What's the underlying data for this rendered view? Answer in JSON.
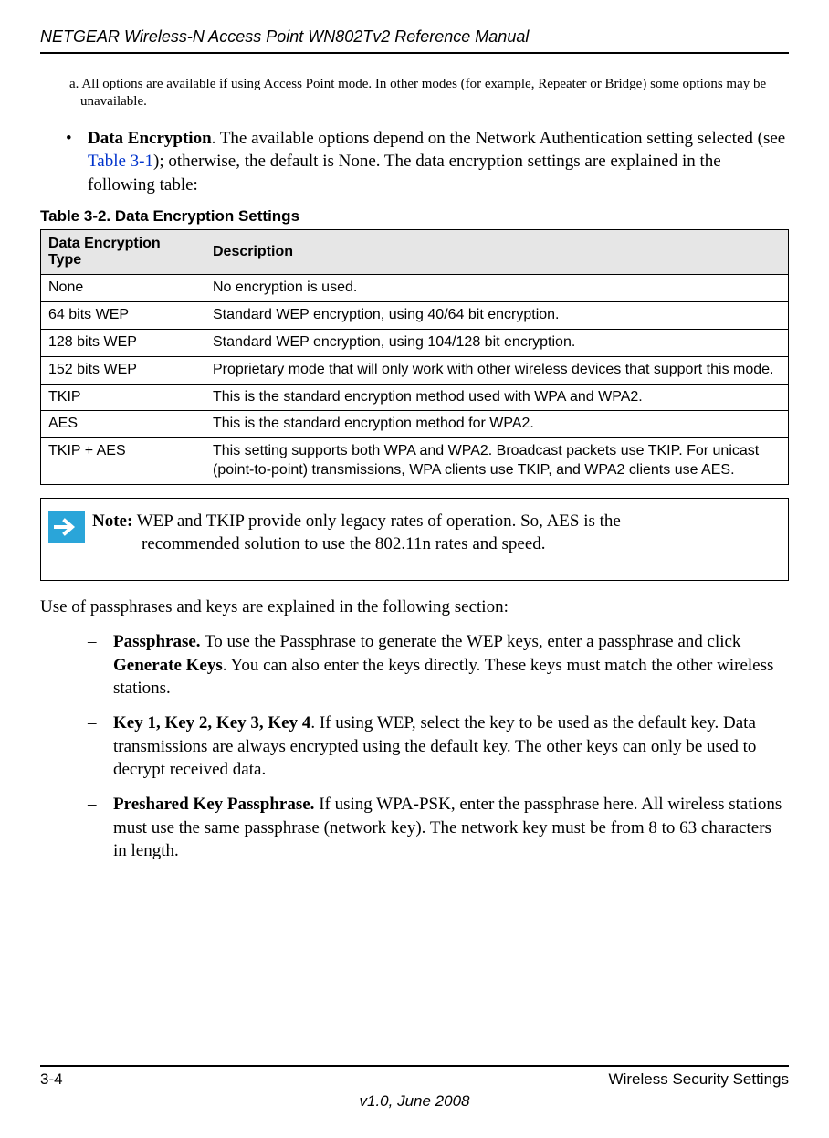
{
  "header": {
    "manual_title": "NETGEAR Wireless-N Access Point WN802Tv2 Reference Manual"
  },
  "footnote": {
    "text": "a. All options are available if using Access Point mode. In other modes (for example, Repeater or Bridge) some options may be unavailable."
  },
  "bullet": {
    "marker": "•",
    "term": "Data Encryption",
    "before_link": ". The available options depend on the Network Authentication setting selected (see ",
    "link_text": "Table 3-1",
    "after_link": "); otherwise, the default is None. The data encryption settings are explained in the following table:"
  },
  "table": {
    "caption": "Table 3-2. Data Encryption Settings",
    "headers": {
      "col1": "Data Encryption Type",
      "col2": "Description"
    },
    "rows": [
      {
        "type": "None",
        "desc": "No encryption is used."
      },
      {
        "type": "64 bits WEP",
        "desc": "Standard WEP encryption, using 40/64 bit encryption."
      },
      {
        "type": "128 bits WEP",
        "desc": "Standard WEP encryption, using 104/128 bit encryption."
      },
      {
        "type": "152 bits WEP",
        "desc": "Proprietary mode that will only work with other wireless devices that support this mode."
      },
      {
        "type": "TKIP",
        "desc": "This is the standard encryption method used with WPA and WPA2."
      },
      {
        "type": "AES",
        "desc": "This is the standard encryption method for WPA2."
      },
      {
        "type": "TKIP + AES",
        "desc": "This setting supports both WPA and WPA2. Broadcast packets use TKIP. For unicast (point-to-point) transmissions, WPA clients use TKIP, and WPA2 clients use AES."
      }
    ]
  },
  "note": {
    "label": "Note:",
    "line1": "  WEP and TKIP provide only legacy rates of operation. So, AES is the",
    "line2": "recommended solution to use the 802.11n rates and speed."
  },
  "section_intro": "Use of passphrases and keys are explained in the following section:",
  "dashes": {
    "marker": "–",
    "items": [
      {
        "term": "Passphrase.",
        "after": " To use the Passphrase to generate the WEP keys, enter a passphrase and click ",
        "bold2": "Generate Keys",
        "after2": ". You can also enter the keys directly. These keys must match the other wireless stations."
      },
      {
        "term": "Key 1, Key 2, Key 3, Key 4",
        "after": ". If using WEP, select the key to be used as the default key. Data transmissions are always encrypted using the default key. The other keys can only be used to decrypt received data.",
        "bold2": "",
        "after2": ""
      },
      {
        "term": "Preshared Key Passphrase.",
        "after": " If using WPA-PSK, enter the passphrase here. All wireless stations must use the same passphrase (network key). The network key must be from 8 to 63 characters in length.",
        "bold2": "",
        "after2": ""
      }
    ]
  },
  "footer": {
    "page_num": "3-4",
    "section_name": "Wireless Security Settings",
    "version": "v1.0, June 2008"
  }
}
